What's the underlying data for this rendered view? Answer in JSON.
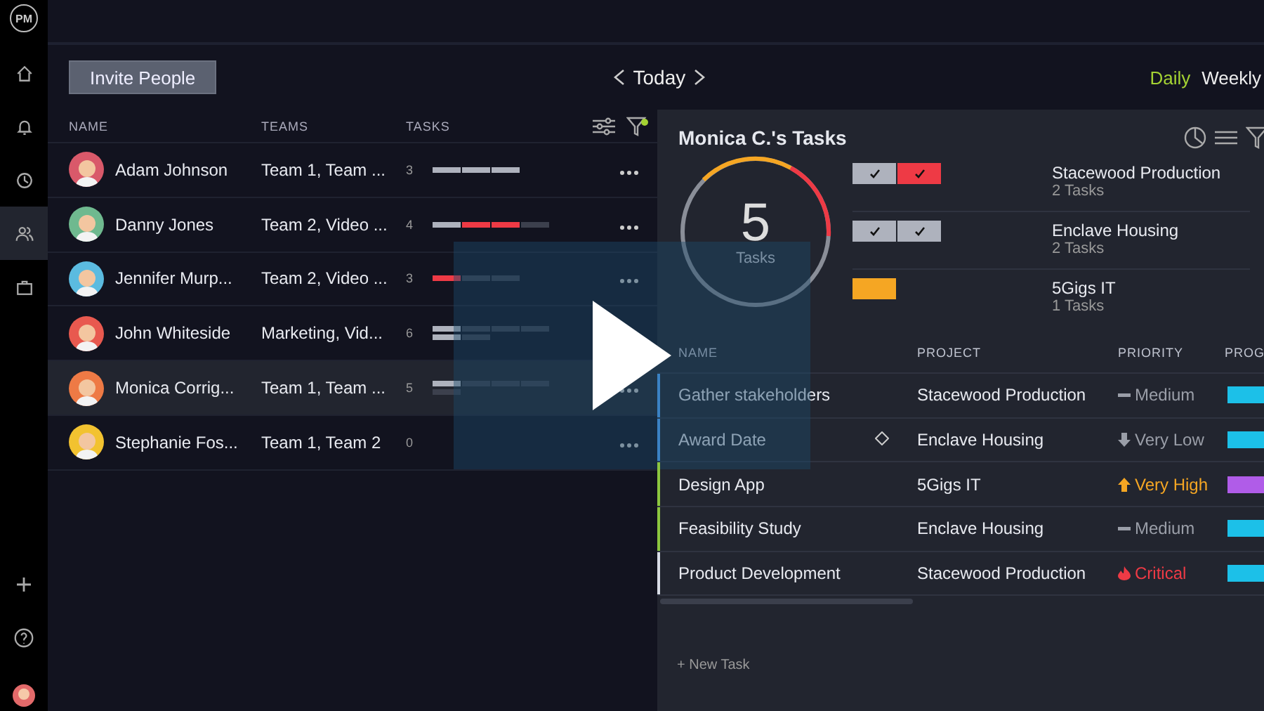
{
  "sidebar": {
    "logo": "PM",
    "items": [
      {
        "kind": "home",
        "selected": false
      },
      {
        "kind": "bell",
        "selected": false
      },
      {
        "kind": "clock",
        "selected": false
      },
      {
        "kind": "people",
        "selected": true
      },
      {
        "kind": "briefcase",
        "selected": false
      }
    ]
  },
  "toolbar": {
    "invite_button": "Invite People",
    "date_label": "Today",
    "views": [
      {
        "label": "Daily",
        "selected": true
      },
      {
        "label": "Weekly",
        "selected": false
      }
    ]
  },
  "people_table": {
    "columns": [
      "NAME",
      "TEAMS",
      "TASKS"
    ],
    "rows": [
      {
        "name": "Adam Johnson",
        "teams": "Team 1, Team ...",
        "tasks": "3",
        "selected": false,
        "color": "#d9596a",
        "segments": [
          {
            "kind": "done"
          },
          {
            "kind": "done"
          },
          {
            "kind": "done"
          }
        ]
      },
      {
        "name": "Danny Jones",
        "teams": "Team 2, Video ...",
        "tasks": "4",
        "selected": false,
        "color": "#6fb98f",
        "segments": [
          {
            "kind": "done"
          },
          {
            "kind": "late"
          },
          {
            "kind": "late"
          },
          {
            "kind": "open"
          }
        ]
      },
      {
        "name": "Jennifer Murp...",
        "teams": "Team 2, Video ...",
        "tasks": "3",
        "selected": false,
        "color": "#5bbbe0",
        "segments": [
          {
            "kind": "late"
          },
          {
            "kind": "open"
          },
          {
            "kind": "open"
          }
        ]
      },
      {
        "name": "John Whiteside",
        "teams": "Marketing, Vid...",
        "tasks": "6",
        "selected": false,
        "color": "#e8594f",
        "segments": [
          {
            "kind": "done"
          },
          {
            "kind": "open"
          },
          {
            "kind": "open"
          },
          {
            "kind": "open"
          },
          {
            "kind": "done"
          },
          {
            "kind": "open"
          }
        ]
      },
      {
        "name": "Monica Corrig...",
        "teams": "Team 1, Team ...",
        "tasks": "5",
        "selected": true,
        "color": "#ee7a45",
        "segments": [
          {
            "kind": "done"
          },
          {
            "kind": "open"
          },
          {
            "kind": "open"
          },
          {
            "kind": "open"
          },
          {
            "kind": "open"
          }
        ]
      },
      {
        "name": "Stephanie Fos...",
        "teams": "Team 1, Team 2",
        "tasks": "0",
        "selected": false,
        "color": "#f2c230"
      }
    ]
  },
  "tasks_panel": {
    "title": "Monica C.'s Tasks",
    "total": "5",
    "total_label": "Tasks",
    "projects": [
      {
        "name": "Stacewood Production",
        "count": "2 Tasks",
        "boxes": [
          {
            "kind": "done_check"
          },
          {
            "kind": "late_check"
          }
        ]
      },
      {
        "name": "Enclave Housing",
        "count": "2 Tasks",
        "boxes": [
          {
            "kind": "done_check"
          },
          {
            "kind": "done_check"
          }
        ]
      },
      {
        "name": "5Gigs IT",
        "count": "1 Tasks",
        "boxes": [
          {
            "kind": "pending"
          }
        ]
      }
    ],
    "columns": [
      "NAME",
      "PROJECT",
      "PRIORITY",
      "PROG"
    ],
    "rows": [
      {
        "name": "Gather stakeholders",
        "kind": "task",
        "project": "Stacewood Production",
        "priority": {
          "label": "Medium",
          "kind": "medium"
        },
        "color": "#3b82c4",
        "progress": {
          "color": "#1cc0e8"
        }
      },
      {
        "name": "Award Date",
        "kind": "milestone",
        "project": "Enclave Housing",
        "priority": {
          "label": "Very Low",
          "kind": "very_low"
        },
        "color": "#3b82c4",
        "progress": {
          "color": "#1cc0e8"
        }
      },
      {
        "name": "Design App",
        "kind": "task",
        "project": "5Gigs IT",
        "priority": {
          "label": "Very High",
          "kind": "very_high"
        },
        "color": "#8cc63f",
        "progress": {
          "color": "#b05ce8"
        }
      },
      {
        "name": "Feasibility Study",
        "kind": "task",
        "project": "Enclave Housing",
        "priority": {
          "label": "Medium",
          "kind": "medium"
        },
        "color": "#8cc63f",
        "progress": {
          "color": "#1cc0e8"
        }
      },
      {
        "name": "Product Development",
        "kind": "task",
        "project": "Stacewood Production",
        "priority": {
          "label": "Critical",
          "kind": "critical"
        },
        "color": "#d8dce6",
        "progress": {
          "color": "#1cc0e8"
        }
      }
    ],
    "new_task": "+ New Task"
  }
}
